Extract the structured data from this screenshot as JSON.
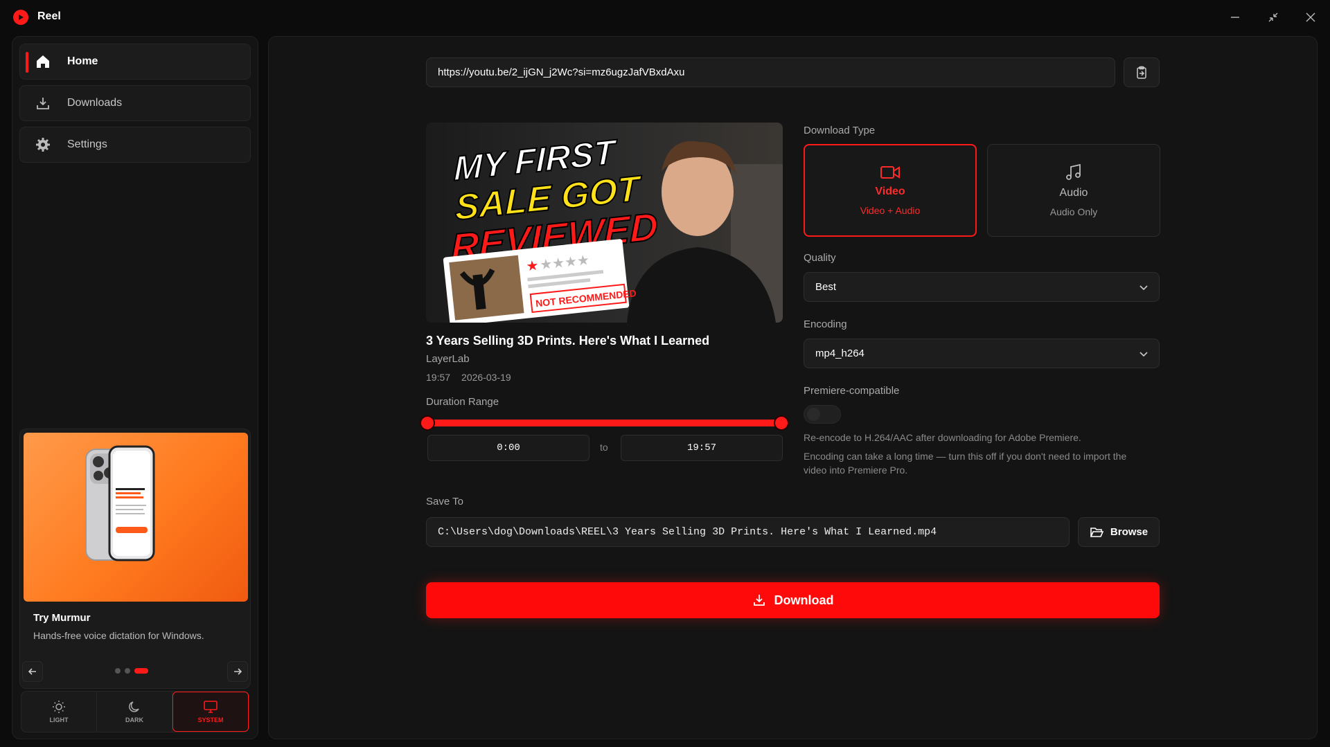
{
  "app": {
    "title": "Reel"
  },
  "sidebar": {
    "items": [
      {
        "label": "Home",
        "icon": "home-icon"
      },
      {
        "label": "Downloads",
        "icon": "download-tray-icon"
      },
      {
        "label": "Settings",
        "icon": "gear-icon"
      }
    ],
    "promo": {
      "title": "Try Murmur",
      "subtitle": "Hands-free voice dictation for Windows.",
      "phone_headline": "Helping Ambitious Brands Win More Customers Online"
    },
    "carousel": {
      "total": 3,
      "active": 3
    },
    "theme": {
      "options": [
        {
          "label": "LIGHT",
          "icon": "sun-icon"
        },
        {
          "label": "DARK",
          "icon": "moon-icon"
        },
        {
          "label": "SYSTEM",
          "icon": "monitor-icon"
        }
      ],
      "selected": "SYSTEM"
    }
  },
  "main": {
    "url": "https://youtu.be/2_ijGN_j2Wc?si=mz6ugzJafVBxdAxu",
    "video": {
      "thumbnail_text": [
        "MY FIRST",
        "SALE GOT",
        "REVIEWED"
      ],
      "thumbnail_badge": "NOT RECOMMENDED",
      "title": "3 Years Selling 3D Prints. Here's What I Learned",
      "channel": "LayerLab",
      "duration": "19:57",
      "date": "2026-03-19"
    },
    "duration_range": {
      "label": "Duration Range",
      "start": "0:00",
      "end": "19:57",
      "separator": "to"
    },
    "download_type": {
      "label": "Download Type",
      "options": [
        {
          "title": "Video",
          "subtitle": "Video + Audio",
          "icon": "video-camera-icon"
        },
        {
          "title": "Audio",
          "subtitle": "Audio Only",
          "icon": "music-note-icon"
        }
      ],
      "selected": "Video"
    },
    "quality": {
      "label": "Quality",
      "value": "Best"
    },
    "encoding": {
      "label": "Encoding",
      "value": "mp4_h264"
    },
    "premiere": {
      "label": "Premiere-compatible",
      "enabled": false,
      "desc1": "Re-encode to H.264/AAC after downloading for Adobe Premiere.",
      "desc2_line1": "Encoding can take a long time — turn this off if you don't need to import the",
      "desc2_line2": "video into Premiere Pro."
    },
    "save_to": {
      "label": "Save To",
      "path": "C:\\Users\\dog\\Downloads\\REEL\\3 Years Selling 3D Prints. Here's What I Learned.mp4",
      "browse_label": "Browse"
    },
    "download_label": "Download",
    "colors": {
      "accent": "#ff1a1a",
      "background": "#0c0c0c",
      "panel": "#141414"
    }
  }
}
